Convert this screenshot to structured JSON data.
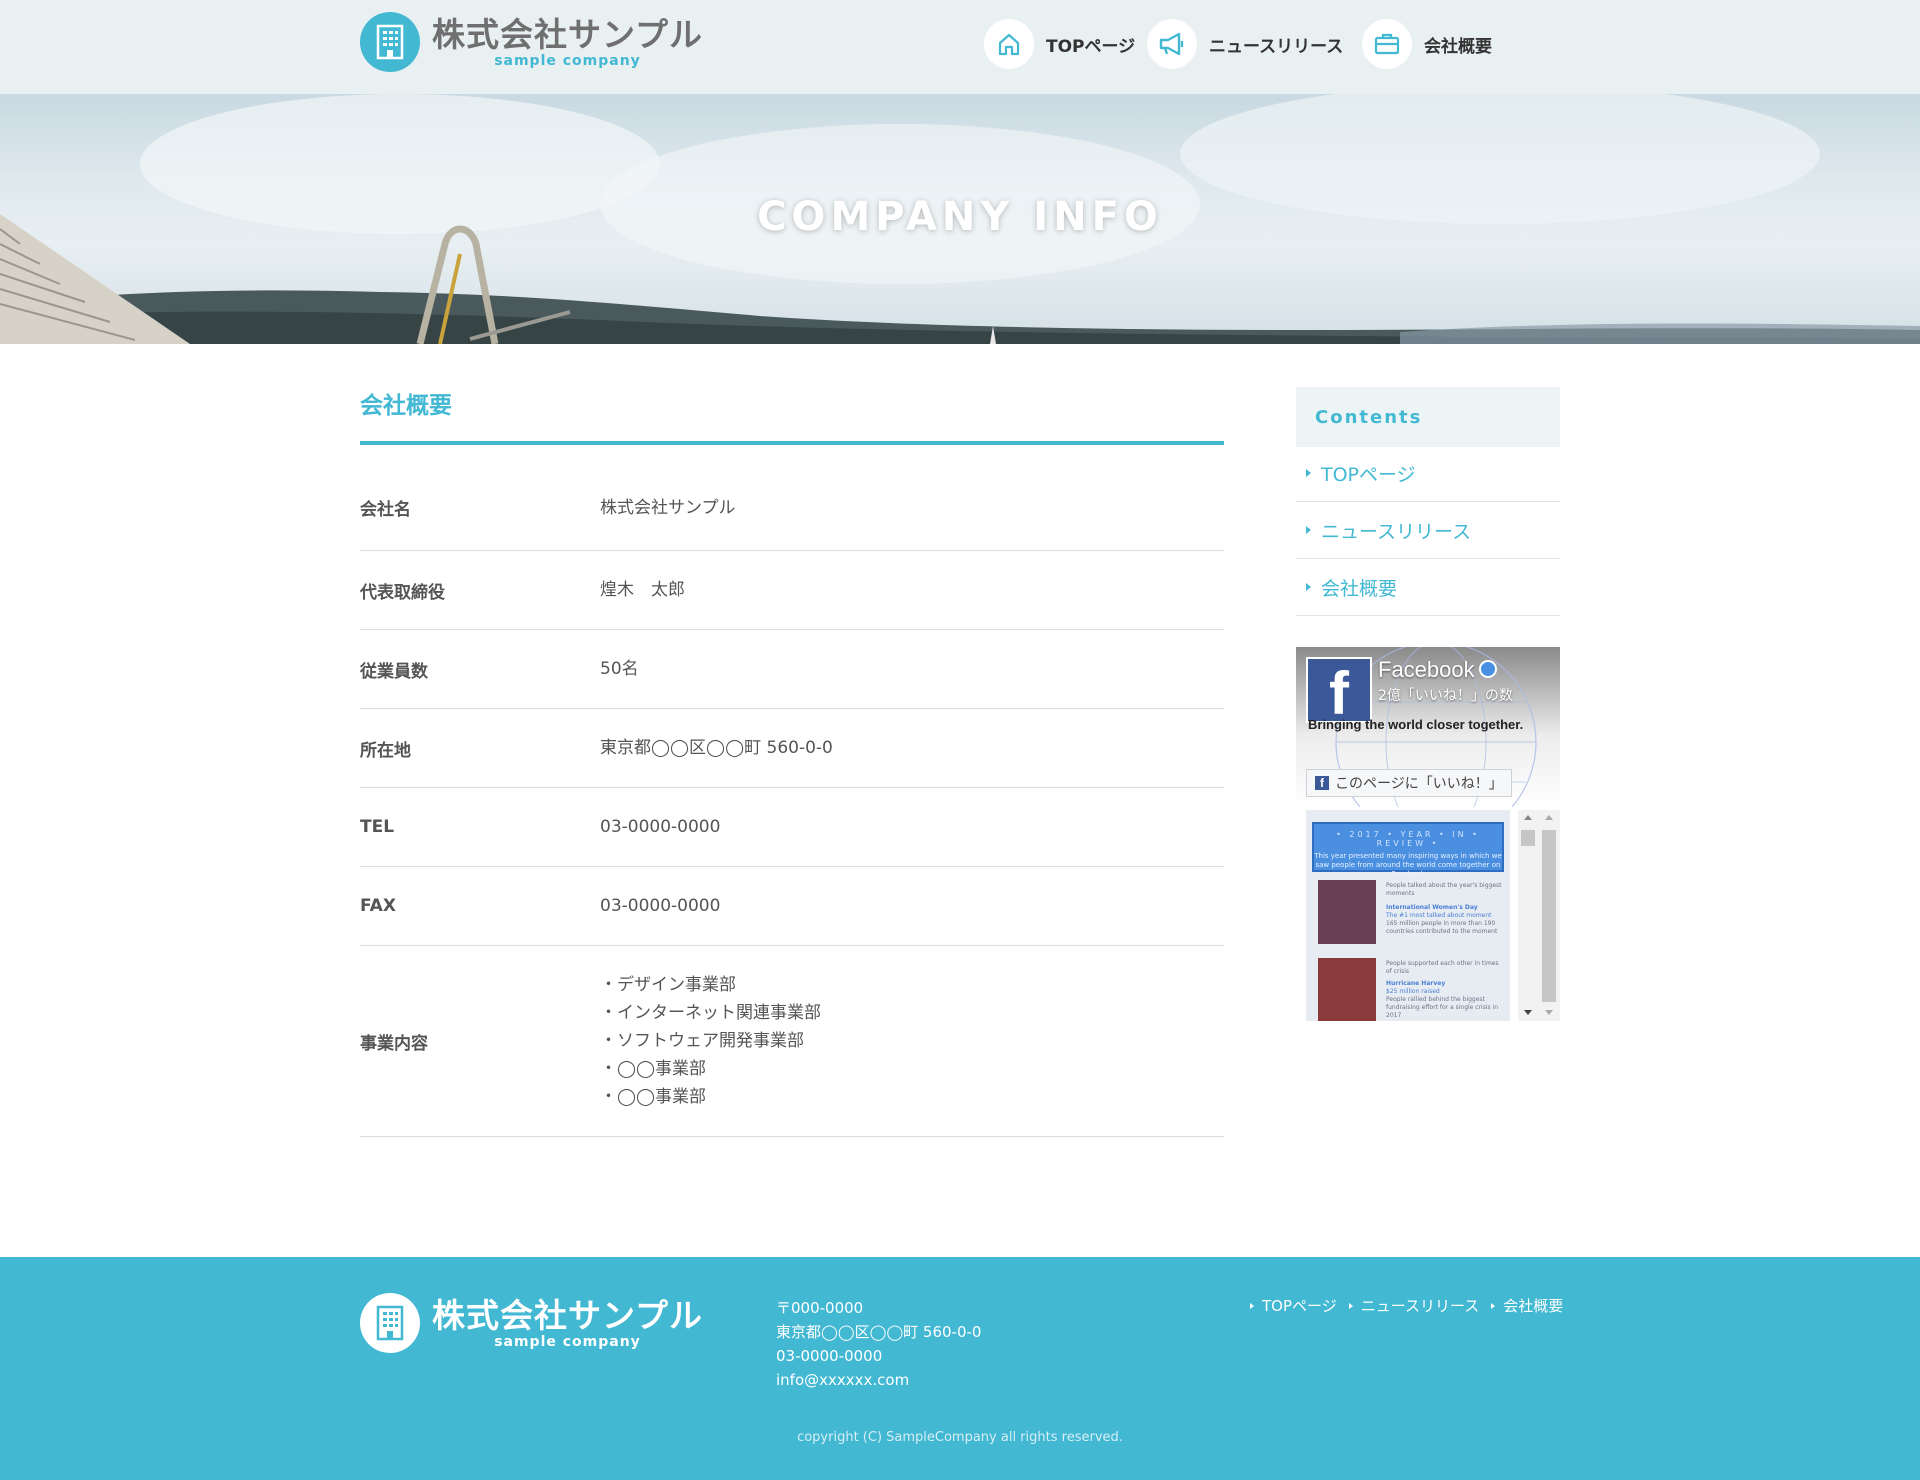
{
  "header": {
    "logo_name": "株式会社サンプル",
    "logo_sub": "sample company",
    "nav": [
      {
        "label": "TOPページ",
        "icon": "home-icon"
      },
      {
        "label": "ニュースリリース",
        "icon": "megaphone-icon"
      },
      {
        "label": "会社概要",
        "icon": "briefcase-icon"
      }
    ]
  },
  "hero": {
    "title": "COMPANY INFO"
  },
  "main": {
    "title": "会社概要",
    "rows": [
      {
        "key": "会社名",
        "value": "株式会社サンプル"
      },
      {
        "key": "代表取締役",
        "value": "煌木　太郎"
      },
      {
        "key": "従業員数",
        "value": "50名"
      },
      {
        "key": "所在地",
        "value": "東京都◯◯区◯◯町 560-0-0"
      },
      {
        "key": "TEL",
        "value": "03-0000-0000"
      },
      {
        "key": "FAX",
        "value": "03-0000-0000"
      }
    ],
    "business": {
      "key": "事業内容",
      "items": [
        "・デザイン事業部",
        "・インターネット関連事業部",
        "・ソフトウェア開発事業部",
        "・◯◯事業部",
        "・◯◯事業部"
      ]
    }
  },
  "sidebar": {
    "heading": "Contents",
    "items": [
      "TOPページ",
      "ニュースリリース",
      "会社概要"
    ],
    "facebook": {
      "name": "Facebook",
      "likes": "2億「いいね！」の数",
      "tagline": "Bringing the world closer together.",
      "like_button": "このページに「いいね！」",
      "post_banner": "• 2017 • YEAR • IN • REVIEW •",
      "post_intro": "This year presented many inspiring ways in which we saw people from around the world come together on Facebook",
      "post1_lead": "People talked about the year's biggest moments",
      "post1_title": "International Women's Day",
      "post1_sub": "The #1 most talked about moment",
      "post1_body": "165 million people in more than 190 countries contributed to the moment",
      "post2_lead": "People supported each other in times of crisis",
      "post2_title": "Hurricane Harvey",
      "post2_sub": "$25 million raised",
      "post2_body": "People rallied behind the biggest fundraising effort for a single crisis in 2017"
    }
  },
  "footer": {
    "logo_name": "株式会社サンプル",
    "logo_sub": "sample company",
    "postal": "〒000-0000",
    "address": "東京都◯◯区◯◯町 560-0-0",
    "tel": "03-0000-0000",
    "email": "info@xxxxxx.com",
    "links": [
      "TOPページ",
      "ニュースリリース",
      "会社概要"
    ],
    "copyright": "copyright (C) SampleCompany all rights reserved."
  },
  "colors": {
    "accent": "#42b8d3",
    "header_bg": "#e8f0f2",
    "facebook_blue": "#3b5998"
  }
}
